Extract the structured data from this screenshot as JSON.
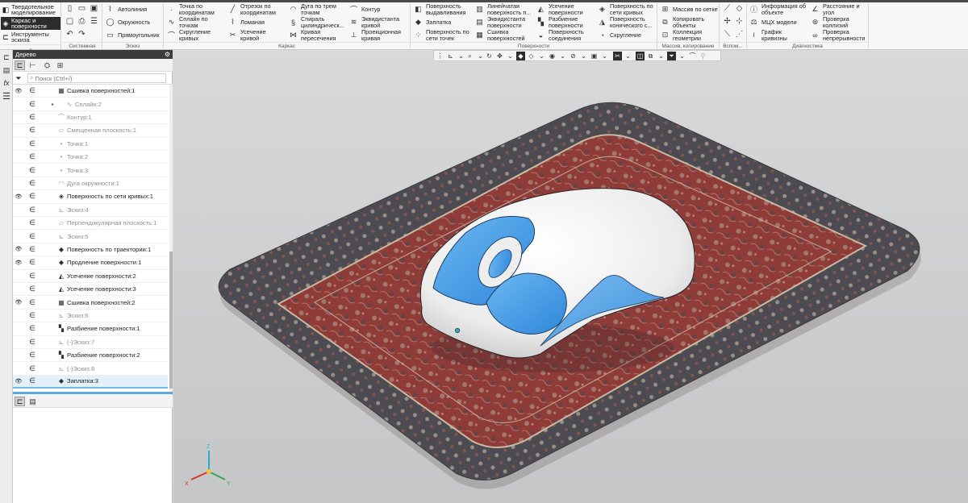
{
  "modes": [
    {
      "label": "Твердотельное\nмоделирование",
      "icon": "solid-icon",
      "active": false
    },
    {
      "label": "Каркас и\nповерхности",
      "icon": "surface-icon",
      "active": true
    },
    {
      "label": "Инструменты\nэскиза",
      "icon": "sketch-icon",
      "active": false
    }
  ],
  "ribbon_groups": {
    "system": "Системная",
    "sketch": "Эскиз",
    "wireframe": "Каркас",
    "surfaces": "Поверхности",
    "array": "Массив, копирование",
    "aux": "Вспом...",
    "diagnostics": "Диагностика"
  },
  "sketch_tools": [
    "Автолиния",
    "Окружность",
    "Прямоугольник"
  ],
  "wireframe_tools": [
    "Точка по\nкоординатам",
    "Сплайн по\nточкам",
    "Скругление\nкривых",
    "Отрезок по\nкоординатам",
    "Ломаная",
    "Усечение\nкривой",
    "Дуга по трем\nточкам",
    "Спираль\nцилиндрическ...",
    "Кривая\nпересечения",
    "Контур",
    "Эквидистанта\nкривой",
    "Проекционная\nкривая"
  ],
  "surface_tools": [
    "Поверхность\nвыдавливания",
    "Заплатка",
    "Поверхность по\nсети точек",
    "Линейчатая\nповерхность п...",
    "Эквидистанта\nповерхности",
    "Сшивка\nповерхностей",
    "Усечение\nповерхности",
    "Разбиение\nповерхности",
    "Поверхность\nсоединения",
    "Поверхность по\nсети кривых",
    "Поверхность\nконического с...",
    "Скругление"
  ],
  "array_tools": [
    "Массив по сетке",
    "Копировать\nобъекты",
    "Коллекция\nгеометрии"
  ],
  "diag_tools": [
    "Информация об\nобъекте",
    "МЦХ модели",
    "График\nкривизны",
    "Расстояние и\nугол",
    "Проверка\nколлизий",
    "Проверка\nнепрерывности"
  ],
  "panel": {
    "title": "Дерево",
    "search_placeholder": "Поиск (Ctrl+/)"
  },
  "tree": [
    {
      "label": "Сшивка поверхностей:1",
      "icon": "stitch-icon",
      "eye": true,
      "dim": false,
      "indent": 0
    },
    {
      "label": "Сплайн:2",
      "icon": "spline-icon",
      "eye": false,
      "dim": true,
      "indent": 1,
      "expand": true
    },
    {
      "label": "Контур:1",
      "icon": "contour-icon",
      "eye": false,
      "dim": true,
      "indent": 0
    },
    {
      "label": "Смещенная плоскость:1",
      "icon": "plane-icon",
      "eye": false,
      "dim": true,
      "indent": 0
    },
    {
      "label": "Точка:1",
      "icon": "point-icon",
      "eye": false,
      "dim": true,
      "indent": 0
    },
    {
      "label": "Точка:2",
      "icon": "point-icon",
      "eye": false,
      "dim": true,
      "indent": 0
    },
    {
      "label": "Точка:3",
      "icon": "point-icon",
      "eye": false,
      "dim": true,
      "indent": 0
    },
    {
      "label": "Дуга окружности:1",
      "icon": "arc-icon",
      "eye": false,
      "dim": true,
      "indent": 0
    },
    {
      "label": "Поверхность по сети кривых:1",
      "icon": "net-surface-icon",
      "eye": true,
      "dim": false,
      "indent": 0
    },
    {
      "label": "Эскиз:4",
      "icon": "sketch-icon",
      "eye": false,
      "dim": true,
      "indent": 0
    },
    {
      "label": "Перпендикулярная плоскость:1",
      "icon": "plane-icon",
      "eye": false,
      "dim": true,
      "indent": 0
    },
    {
      "label": "Эскиз:5",
      "icon": "sketch-icon",
      "eye": false,
      "dim": true,
      "indent": 0
    },
    {
      "label": "Поверхность по траектории:1",
      "icon": "sweep-icon",
      "eye": true,
      "dim": false,
      "indent": 0
    },
    {
      "label": "Продление поверхности:1",
      "icon": "extend-icon",
      "eye": true,
      "dim": false,
      "indent": 0
    },
    {
      "label": "Усечение поверхности:2",
      "icon": "trim-icon",
      "eye": false,
      "dim": false,
      "indent": 0
    },
    {
      "label": "Усечение поверхности:3",
      "icon": "trim-icon",
      "eye": false,
      "dim": false,
      "indent": 0
    },
    {
      "label": "Сшивка поверхностей:2",
      "icon": "stitch-icon",
      "eye": true,
      "dim": false,
      "indent": 0
    },
    {
      "label": "Эскиз:6",
      "icon": "sketch-icon",
      "eye": false,
      "dim": true,
      "indent": 0
    },
    {
      "label": "Разбиение поверхности:1",
      "icon": "split-icon",
      "eye": false,
      "dim": false,
      "indent": 0
    },
    {
      "label": "(-)Эскиз:7",
      "icon": "sketch-icon",
      "eye": false,
      "dim": true,
      "indent": 0
    },
    {
      "label": "Разбиение поверхности:2",
      "icon": "split-icon",
      "eye": false,
      "dim": false,
      "indent": 0
    },
    {
      "label": "(-)Эскиз:8",
      "icon": "sketch-icon",
      "eye": false,
      "dim": true,
      "indent": 0
    },
    {
      "label": "Заплатка:3",
      "icon": "patch-icon",
      "eye": true,
      "dim": false,
      "indent": 0,
      "selected": true
    }
  ],
  "axes": {
    "x": "X",
    "y": "Y",
    "z": "Z"
  },
  "colors": {
    "accent_blue": "#3d9be9",
    "mouse_white": "#f4f4f4",
    "rug_red": "#8e3a36",
    "rug_border": "#4f4e54",
    "selection": "#6fb9e6"
  }
}
